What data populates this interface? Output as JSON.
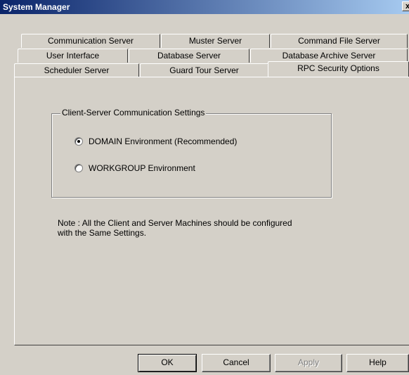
{
  "window": {
    "title": "System Manager",
    "close_glyph": "x"
  },
  "tabs": {
    "row1": [
      "Communication Server",
      "Muster Server",
      "Command File Server"
    ],
    "row2": [
      "User Interface",
      "Database Server",
      "Database Archive Server"
    ],
    "row3": [
      "Scheduler Server",
      "Guard Tour Server",
      "RPC Security Options"
    ],
    "active": "RPC Security Options"
  },
  "group": {
    "title": "Client-Server Communication Settings",
    "options": [
      {
        "label": "DOMAIN Environment (Recommended)",
        "selected": true
      },
      {
        "label": "WORKGROUP Environment",
        "selected": false
      }
    ]
  },
  "note": {
    "line1": "Note : All the Client and Server Machines should be configured",
    "line2": "with the Same Settings."
  },
  "buttons": {
    "ok": "OK",
    "cancel": "Cancel",
    "apply": "Apply",
    "help": "Help"
  }
}
